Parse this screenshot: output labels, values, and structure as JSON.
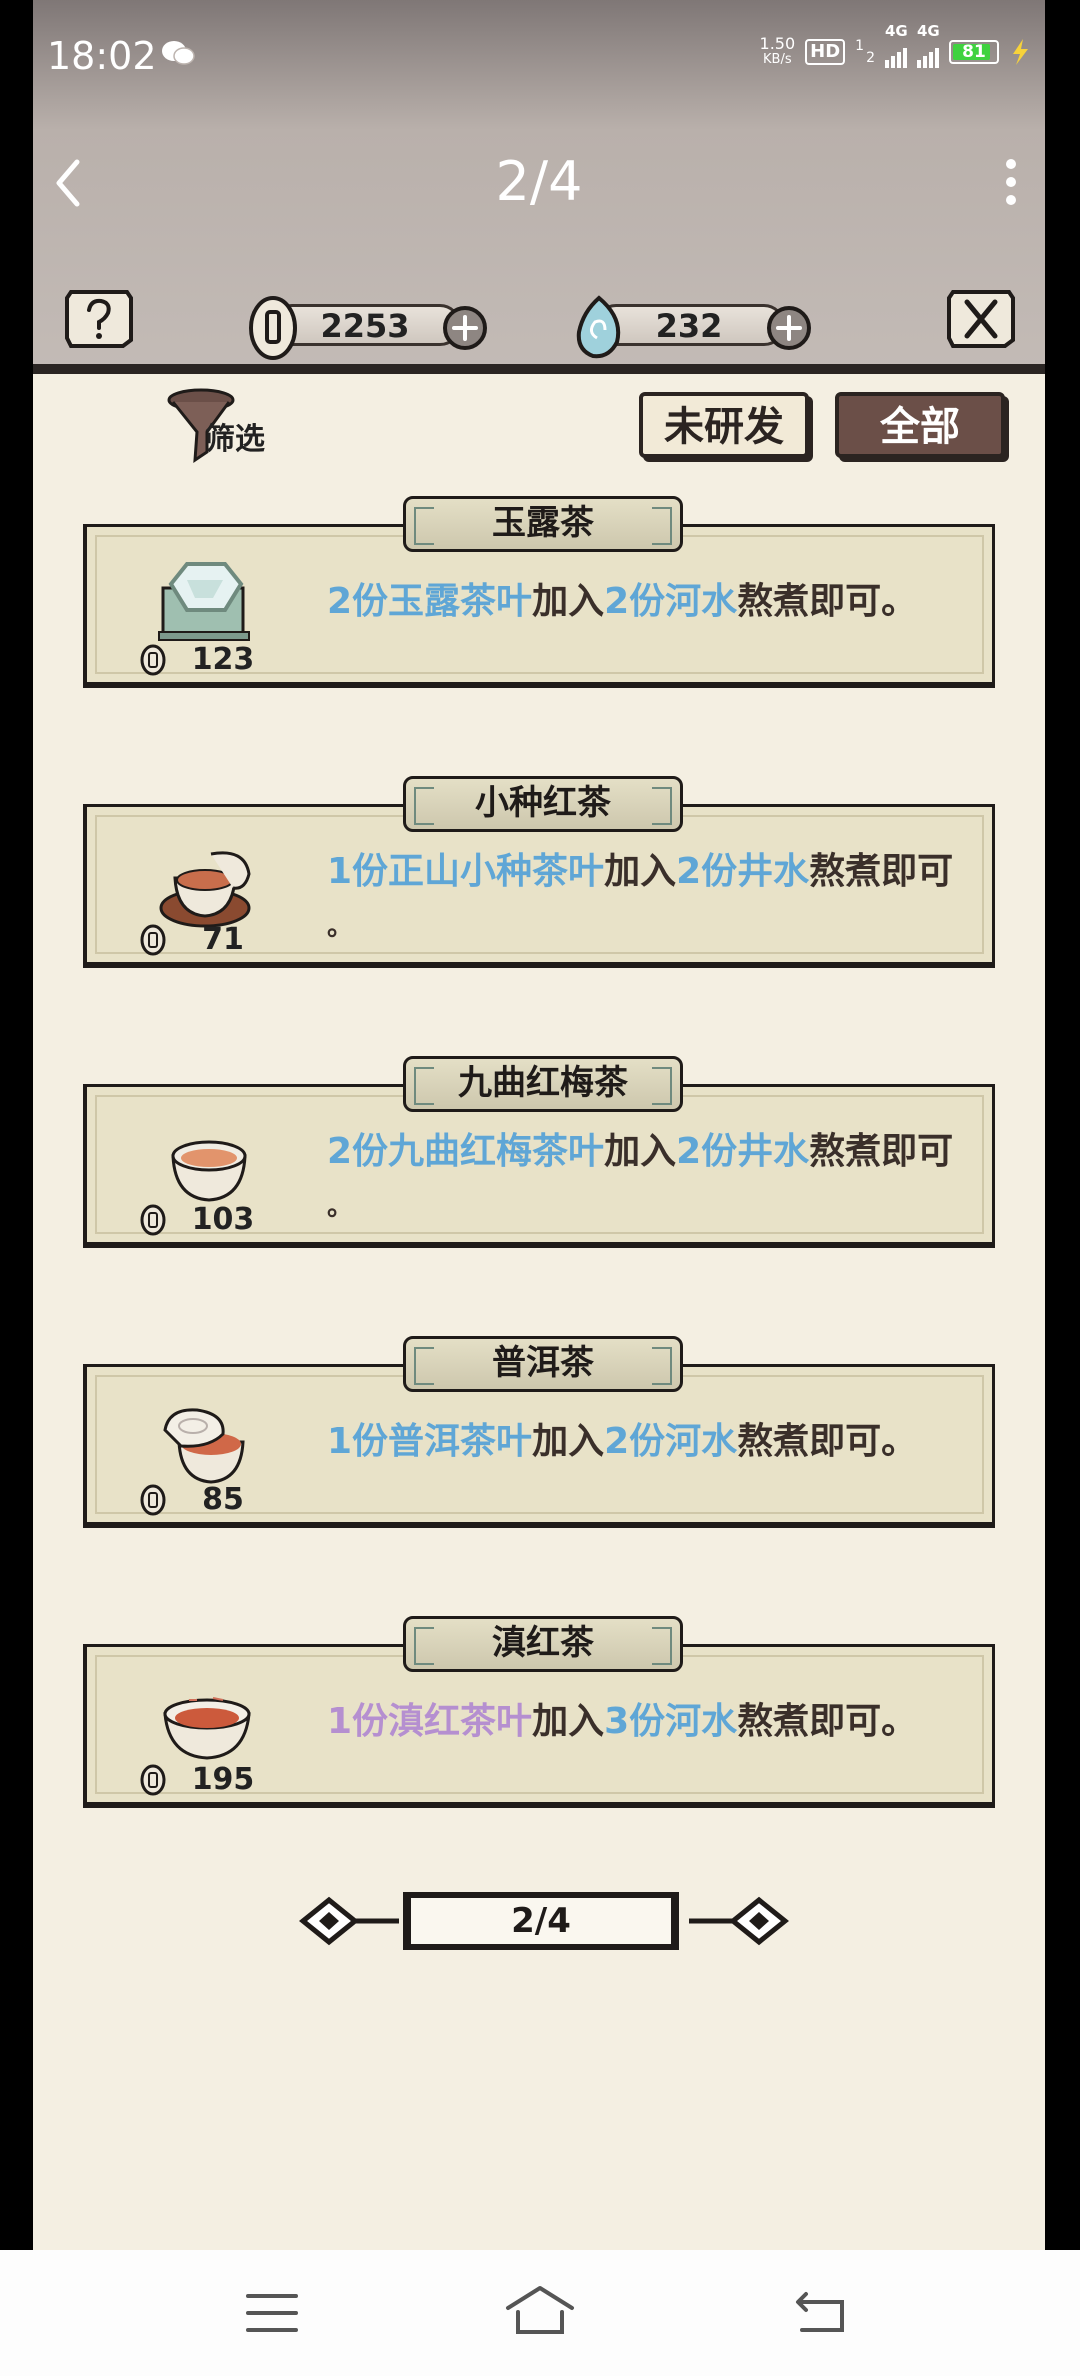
{
  "status_bar": {
    "time": "18:02",
    "speed_value": "1.50",
    "speed_unit": "KB/s",
    "hd": "HD",
    "sim_index": "1",
    "sim_index_2": "2",
    "network_1": "4G",
    "network_2": "4G",
    "battery": "81"
  },
  "header": {
    "title": "2/4"
  },
  "resources": {
    "coins": "2253",
    "gems": "232"
  },
  "filter": {
    "label": "筛选"
  },
  "buttons": {
    "undeveloped": "未研发",
    "all": "全部"
  },
  "recipes": [
    {
      "name": "玉露茶",
      "price": "123",
      "parts": [
        "2份玉露茶叶",
        "加入",
        "2份河水",
        "熬煮即可。"
      ]
    },
    {
      "name": "小种红茶",
      "price": "71",
      "parts": [
        "1份正山小种茶叶",
        "加入",
        "2份井水",
        "熬煮即可",
        "。"
      ]
    },
    {
      "name": "九曲红梅茶",
      "price": "103",
      "parts": [
        "2份九曲红梅茶叶",
        "加入",
        "2份井水",
        "熬煮即可",
        "。"
      ]
    },
    {
      "name": "普洱茶",
      "price": "85",
      "parts": [
        "1份普洱茶叶",
        "加入",
        "2份河水",
        "熬煮即可。"
      ]
    },
    {
      "name": "滇红茶",
      "price": "195",
      "parts": [
        "1份滇红茶叶",
        "加入",
        "3份河水",
        "熬煮即可。"
      ]
    }
  ],
  "pager": {
    "label": "2/4"
  },
  "colors": {
    "ingredient_blue": "#5fa6d6",
    "ingredient_purple": "#b58fd0",
    "ink": "#1f1b19",
    "paper": "#f4efe2"
  }
}
